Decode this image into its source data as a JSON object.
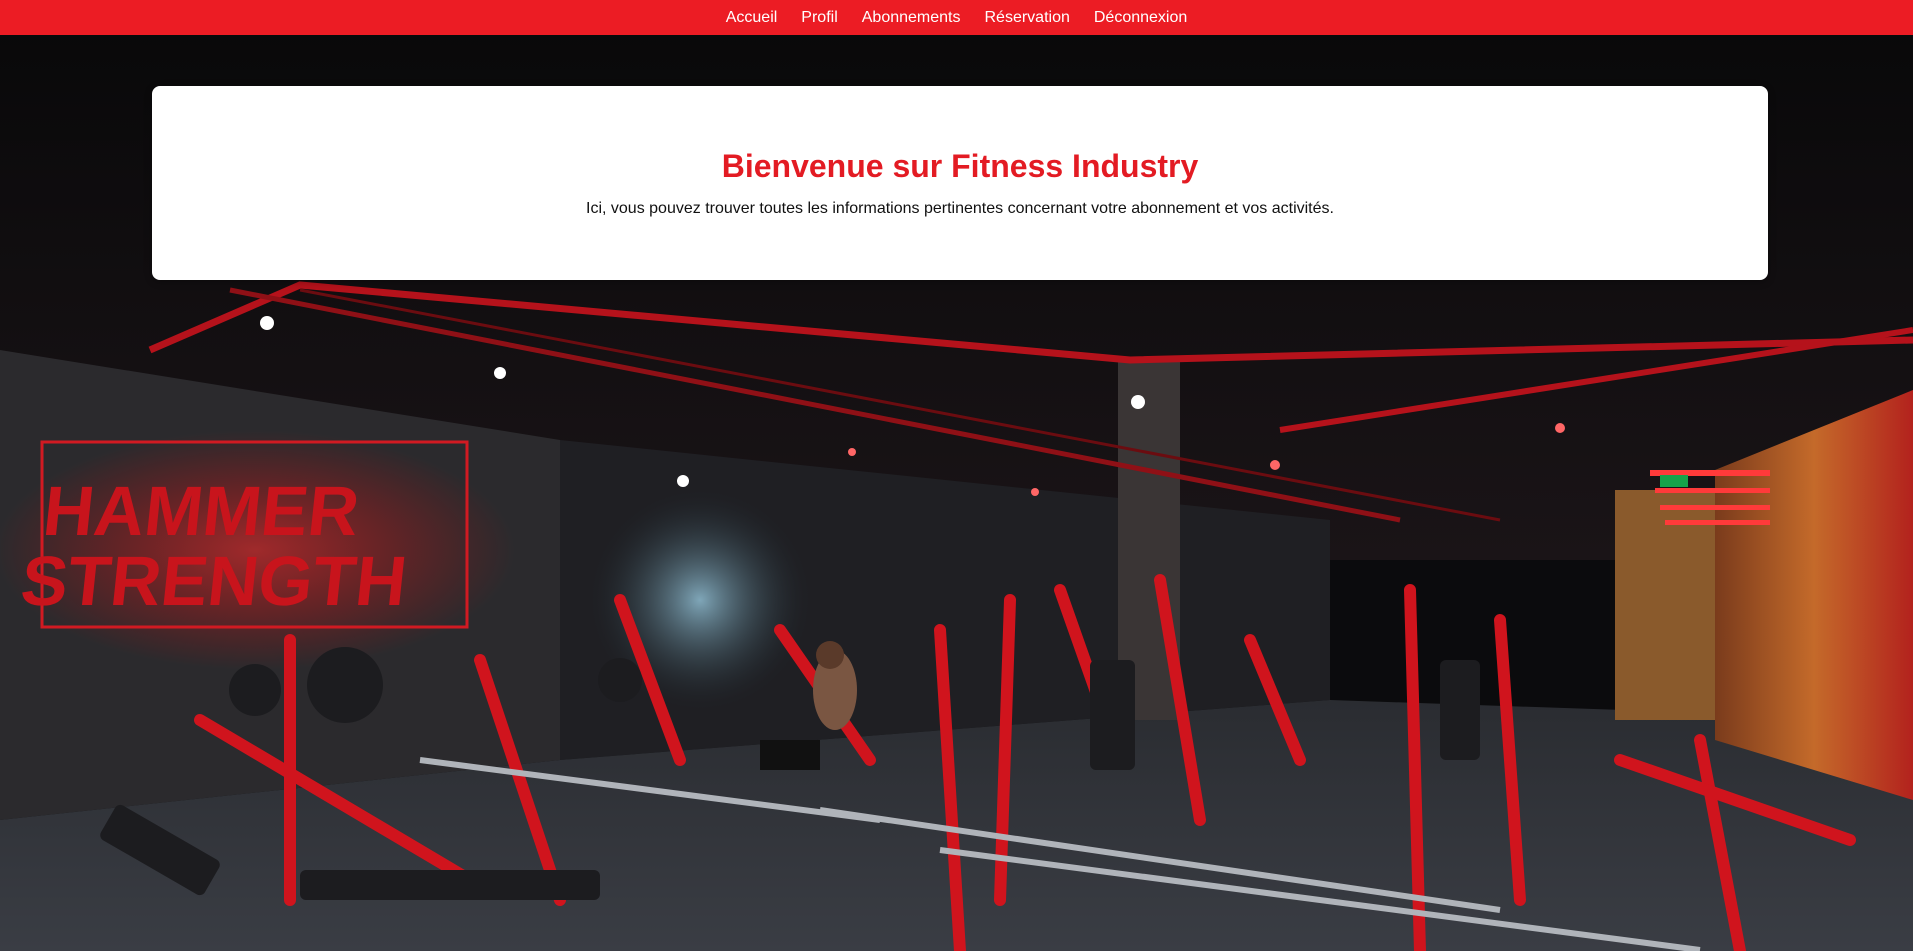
{
  "nav": {
    "items": [
      {
        "label": "Accueil"
      },
      {
        "label": "Profil"
      },
      {
        "label": "Abonnements"
      },
      {
        "label": "Réservation"
      },
      {
        "label": "Déconnexion"
      }
    ]
  },
  "welcome": {
    "title": "Bienvenue sur Fitness Industry",
    "description": "Ici, vous pouvez trouver toutes les informations pertinentes concernant votre abonnement et vos activités."
  },
  "background": {
    "sign_line1": "HAMMER",
    "sign_line2": "STRENGTH"
  },
  "colors": {
    "brand_red": "#ec1c24",
    "title_red": "#e31b23"
  }
}
